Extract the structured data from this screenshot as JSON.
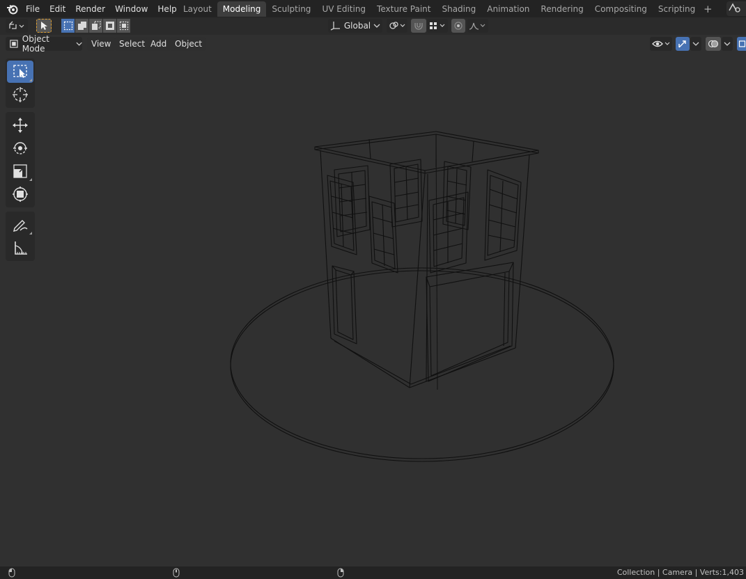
{
  "menu": {
    "logo_icon": "blender-logo-icon",
    "items": [
      "File",
      "Edit",
      "Render",
      "Window",
      "Help"
    ]
  },
  "workspaces": {
    "tabs": [
      "Layout",
      "Modeling",
      "Sculpting",
      "UV Editing",
      "Texture Paint",
      "Shading",
      "Animation",
      "Rendering",
      "Compositing",
      "Scripting"
    ],
    "active": "Modeling",
    "add_icon": "plus-icon"
  },
  "toolheader": {
    "orientation": "Global"
  },
  "viewheader": {
    "mode": "Object Mode",
    "menus": [
      "View",
      "Select",
      "Add",
      "Object"
    ]
  },
  "toolbar": {
    "tools": [
      "select-box",
      "cursor",
      "move",
      "rotate",
      "scale",
      "transform",
      "annotate",
      "measure"
    ],
    "active": "select-box"
  },
  "status": {
    "stats": "Collection | Camera | Verts:1,403"
  },
  "colors": {
    "accent": "#4772b3",
    "background": "#303030",
    "wire": "#101010"
  }
}
